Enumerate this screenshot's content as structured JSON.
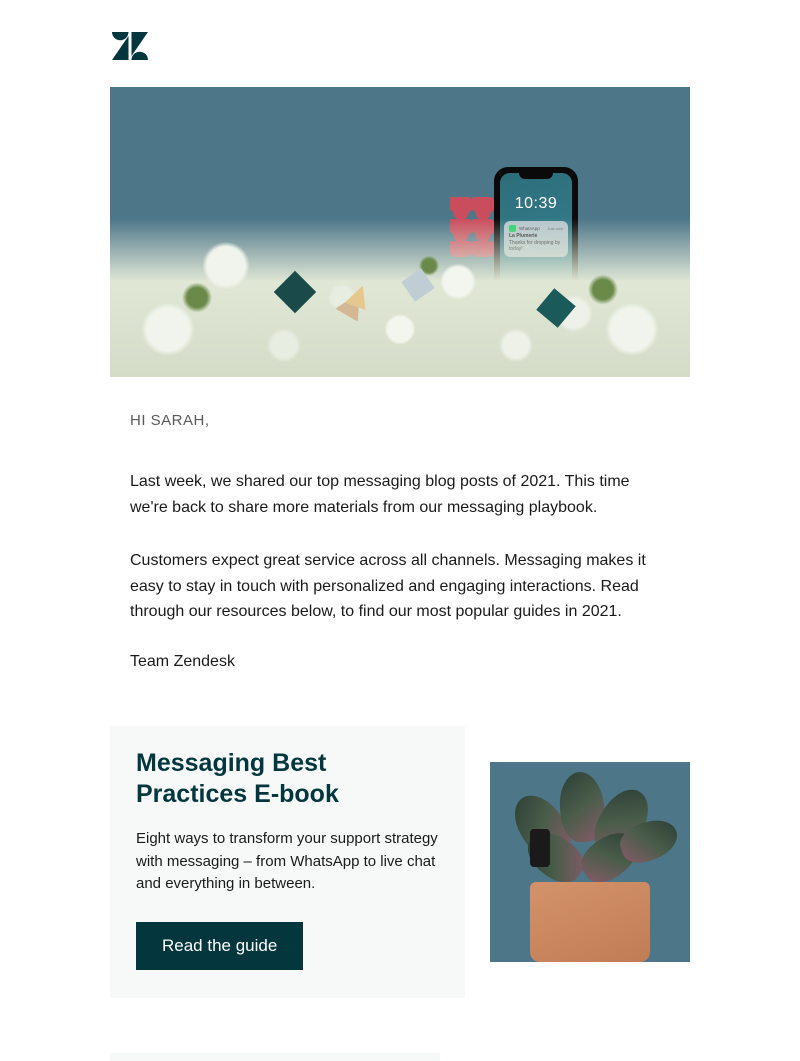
{
  "brand": {
    "logo_color": "#03363d"
  },
  "hero": {
    "phone_time": "10:39",
    "notification": {
      "app": "WhatsApp",
      "sender": "La Plumerie",
      "message": "Thanks for dropping by today! 🍵",
      "time": "Just now"
    }
  },
  "greeting": "HI SARAH,",
  "paragraphs": [
    "Last week, we shared our top messaging blog posts of 2021. This time we're back to share more materials from our messaging playbook.",
    "Customers expect great service across all channels. Messaging makes it easy to stay in touch with personalized and engaging interactions. Read through our resources below, to find our most popular guides in 2021."
  ],
  "signoff": "Team Zendesk",
  "card": {
    "title": "Messaging Best Practices E-book",
    "description": "Eight ways to transform your support strategy with messaging – from WhatsApp to live chat and everything in between.",
    "button": "Read the guide"
  }
}
